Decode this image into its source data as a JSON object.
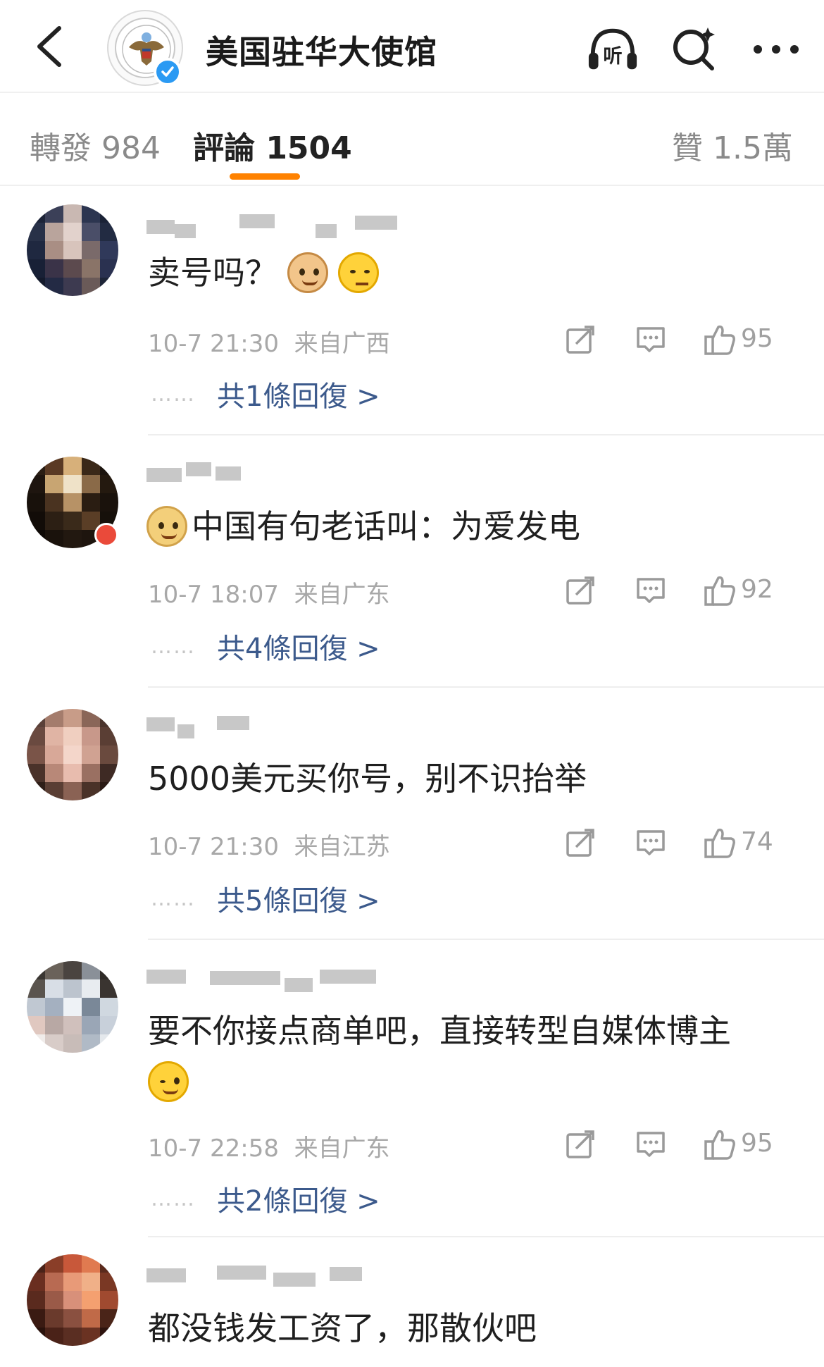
{
  "header": {
    "account_name": "美国驻华大使馆",
    "icons": [
      "back-arrow-icon",
      "listen-icon",
      "search-icon",
      "more-icon"
    ],
    "listen_label": "听"
  },
  "tabs": {
    "forward": "轉發 984",
    "comments": "評論 1504",
    "likes": "贊 1.5萬",
    "accent_color": "#ff8200"
  },
  "comments": [
    {
      "user_name": "",
      "text": "卖号吗？",
      "emojis": [
        "cat-emoji",
        "smug-emoji"
      ],
      "time": "10-7 21:30",
      "location": "来自广西",
      "likes": "95",
      "replies": "共1條回復 >"
    },
    {
      "user_name": "",
      "text": "中国有句老话叫：为爱发电",
      "emojis_before": [
        "doge-emoji"
      ],
      "time": "10-7 18:07",
      "location": "来自广东",
      "likes": "92",
      "replies": "共4條回復 >"
    },
    {
      "user_name": "",
      "text": "5000美元买你号，别不识抬举",
      "time": "10-7 21:30",
      "location": "来自江苏",
      "likes": "74",
      "replies": "共5條回復 >"
    },
    {
      "user_name": "",
      "text": "要不你接点商单吧，直接转型自媒体博主",
      "emojis": [
        "wink-emoji"
      ],
      "time": "10-7 22:58",
      "location": "来自广东",
      "likes": "95",
      "replies": "共2條回復 >"
    },
    {
      "user_name": "",
      "text": "都没钱发工资了，那散伙吧"
    }
  ],
  "action_icons": [
    "repost-icon",
    "comment-icon",
    "like-icon"
  ],
  "colors": {
    "reply_link": "#3c5a8c",
    "meta_text": "#a8a8a8",
    "verified_badge": "#2b9af3"
  }
}
